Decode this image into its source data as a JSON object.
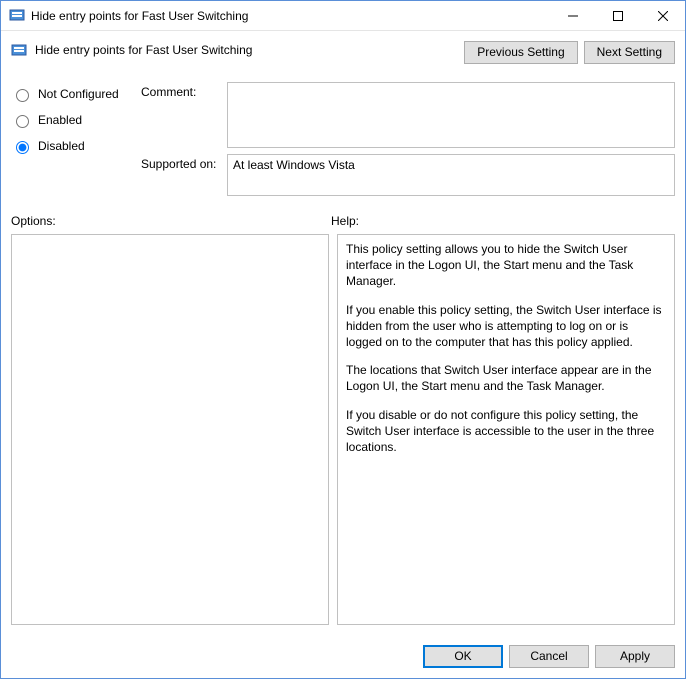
{
  "window": {
    "title": "Hide entry points for Fast User Switching"
  },
  "header": {
    "title": "Hide entry points for Fast User Switching"
  },
  "nav": {
    "previous": "Previous Setting",
    "next": "Next Setting"
  },
  "state": {
    "not_configured": "Not Configured",
    "enabled": "Enabled",
    "disabled": "Disabled",
    "selected": "disabled"
  },
  "fields": {
    "comment_label": "Comment:",
    "comment_value": "",
    "supported_label": "Supported on:",
    "supported_value": "At least Windows Vista"
  },
  "sections": {
    "options_label": "Options:",
    "help_label": "Help:"
  },
  "help": {
    "p1": "This policy setting allows you to hide the Switch User interface in the Logon UI, the Start menu and the Task Manager.",
    "p2": "If you enable this policy setting, the Switch User interface is hidden from the user who is attempting to log on or is logged on to the computer that has this policy applied.",
    "p3": "The locations that Switch User interface appear are in the Logon UI, the Start menu and the Task Manager.",
    "p4": "If you disable or do not configure this policy setting, the Switch User interface is accessible to the user in the three locations."
  },
  "buttons": {
    "ok": "OK",
    "cancel": "Cancel",
    "apply": "Apply"
  }
}
